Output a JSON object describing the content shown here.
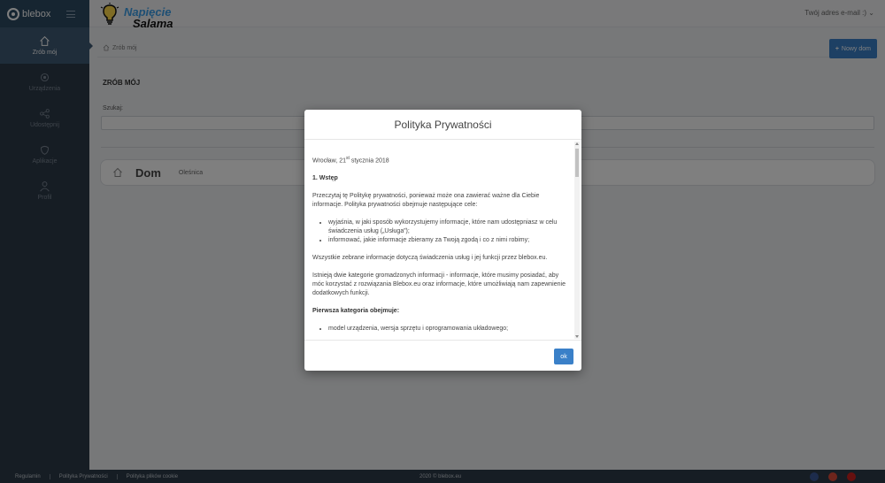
{
  "brand": {
    "name": "blebox"
  },
  "site_logo": {
    "line1": "Napięcie",
    "line2": "Salama"
  },
  "user_menu": {
    "label": "Twój adres e-mail :) ⌄"
  },
  "sidebar": {
    "items": [
      {
        "label": "Zrób mój",
        "icon": "home-icon",
        "active": true
      },
      {
        "label": "Urządzenia",
        "icon": "devices-icon"
      },
      {
        "label": "Udostępnij",
        "icon": "share-icon"
      },
      {
        "label": "Aplikacje",
        "icon": "apps-icon"
      },
      {
        "label": "Profil",
        "icon": "profile-icon"
      }
    ]
  },
  "breadcrumb": {
    "label": "Zrób mój"
  },
  "toolbar": {
    "new_home_label": "Nowy dom"
  },
  "page": {
    "title": "ZRÓB MÓJ",
    "search_label": "Szukaj:"
  },
  "home_card": {
    "name": "Dom",
    "city": "Oleśnica"
  },
  "footer": {
    "links": [
      "Regulamin",
      "Polityka Prywatności",
      "Polityka plików cookie"
    ],
    "copyright": "2020 © blebox.eu",
    "social_colors": [
      "#3b5998",
      "#dd4b39",
      "#cd201f"
    ]
  },
  "modal": {
    "title": "Polityka Prywatności",
    "date_prefix": "Wrocław, 21",
    "date_sup": "st",
    "date_suffix": "stycznia 2018",
    "section1_heading": "1. Wstęp",
    "intro_paragraph": "Przeczytaj tę Politykę prywatności, ponieważ może ona zawierać ważne dla Ciebie informacje. Polityka prywatności obejmuje następujące cele:",
    "bullets": [
      "wyjaśnia, w jaki sposób wykorzystujemy informacje, które nam udostępniasz w celu świadczenia usług („Usługa”);",
      "informować, jakie informacje zbieramy za Twoją zgodą i co z nimi robimy;"
    ],
    "paragraph2": "Wszystkie zebrane informacje dotyczą świadczenia usług i jej funkcji przez blebox.eu.",
    "paragraph3": "Istnieją dwie kategorie gromadzonych informacji - informacje, które musimy posiadać, aby móc korzystać z rozwiązania Blebox.eu oraz informacje, które umożliwiają nam zapewnienie dodatkowych funkcji.",
    "category_heading": "Pierwsza kategoria obejmuje:",
    "category_bullet": "model urządzenia, wersja sprzętu i oprogramowania układowego;",
    "ok_label": "ok"
  }
}
